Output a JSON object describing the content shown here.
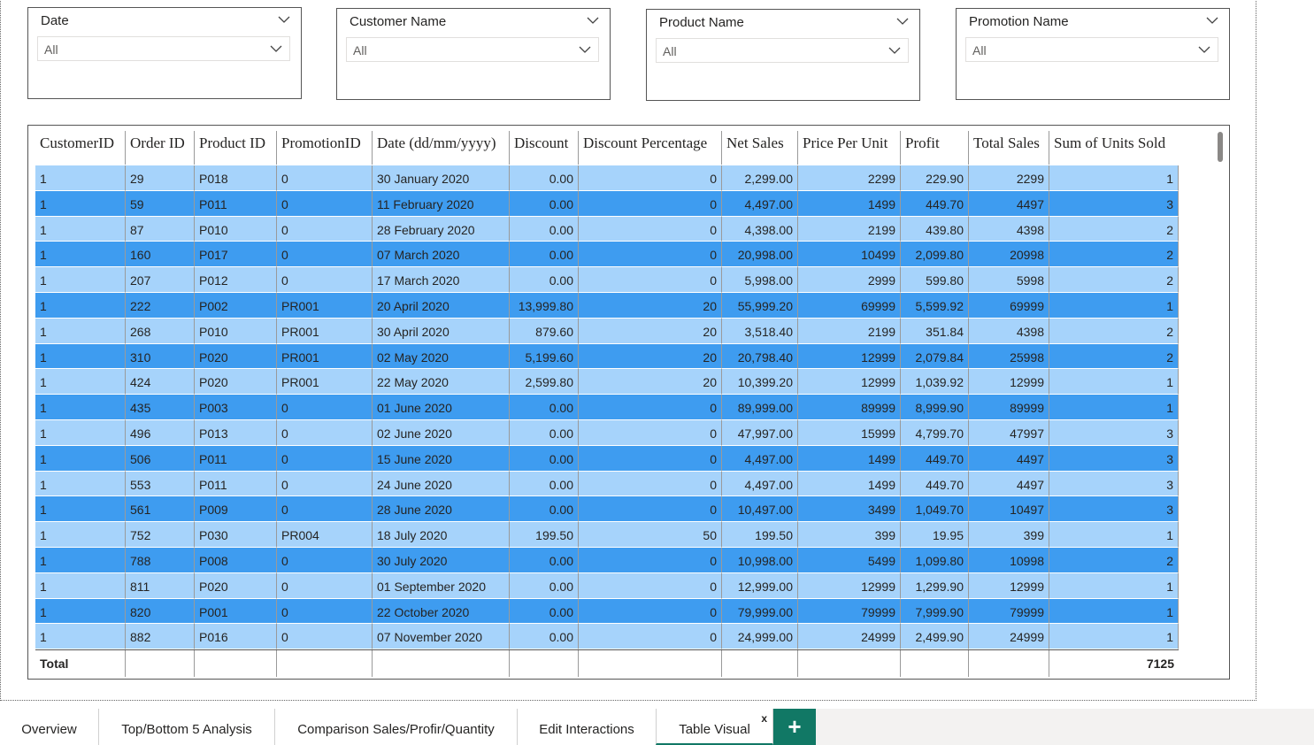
{
  "slicers": [
    {
      "title": "Date",
      "value": "All"
    },
    {
      "title": "Customer Name",
      "value": "All"
    },
    {
      "title": "Product Name",
      "value": "All"
    },
    {
      "title": "Promotion Name",
      "value": "All"
    }
  ],
  "table": {
    "columns": [
      "CustomerID",
      "Order ID",
      "Product ID",
      "PromotionID",
      "Date (dd/mm/yyyy)",
      "Discount",
      "Discount Percentage",
      "Net Sales",
      "Price Per Unit",
      "Profit",
      "Total Sales",
      "Sum of Units Sold"
    ],
    "rows": [
      [
        "1",
        "29",
        "P018",
        "0",
        "30 January 2020",
        "0.00",
        "0",
        "2,299.00",
        "2299",
        "229.90",
        "2299",
        "1"
      ],
      [
        "1",
        "59",
        "P011",
        "0",
        "11 February 2020",
        "0.00",
        "0",
        "4,497.00",
        "1499",
        "449.70",
        "4497",
        "3"
      ],
      [
        "1",
        "87",
        "P010",
        "0",
        "28 February 2020",
        "0.00",
        "0",
        "4,398.00",
        "2199",
        "439.80",
        "4398",
        "2"
      ],
      [
        "1",
        "160",
        "P017",
        "0",
        "07 March 2020",
        "0.00",
        "0",
        "20,998.00",
        "10499",
        "2,099.80",
        "20998",
        "2"
      ],
      [
        "1",
        "207",
        "P012",
        "0",
        "17 March 2020",
        "0.00",
        "0",
        "5,998.00",
        "2999",
        "599.80",
        "5998",
        "2"
      ],
      [
        "1",
        "222",
        "P002",
        "PR001",
        "20 April 2020",
        "13,999.80",
        "20",
        "55,999.20",
        "69999",
        "5,599.92",
        "69999",
        "1"
      ],
      [
        "1",
        "268",
        "P010",
        "PR001",
        "30 April 2020",
        "879.60",
        "20",
        "3,518.40",
        "2199",
        "351.84",
        "4398",
        "2"
      ],
      [
        "1",
        "310",
        "P020",
        "PR001",
        "02 May 2020",
        "5,199.60",
        "20",
        "20,798.40",
        "12999",
        "2,079.84",
        "25998",
        "2"
      ],
      [
        "1",
        "424",
        "P020",
        "PR001",
        "22 May 2020",
        "2,599.80",
        "20",
        "10,399.20",
        "12999",
        "1,039.92",
        "12999",
        "1"
      ],
      [
        "1",
        "435",
        "P003",
        "0",
        "01 June 2020",
        "0.00",
        "0",
        "89,999.00",
        "89999",
        "8,999.90",
        "89999",
        "1"
      ],
      [
        "1",
        "496",
        "P013",
        "0",
        "02 June 2020",
        "0.00",
        "0",
        "47,997.00",
        "15999",
        "4,799.70",
        "47997",
        "3"
      ],
      [
        "1",
        "506",
        "P011",
        "0",
        "15 June 2020",
        "0.00",
        "0",
        "4,497.00",
        "1499",
        "449.70",
        "4497",
        "3"
      ],
      [
        "1",
        "553",
        "P011",
        "0",
        "24 June 2020",
        "0.00",
        "0",
        "4,497.00",
        "1499",
        "449.70",
        "4497",
        "3"
      ],
      [
        "1",
        "561",
        "P009",
        "0",
        "28 June 2020",
        "0.00",
        "0",
        "10,497.00",
        "3499",
        "1,049.70",
        "10497",
        "3"
      ],
      [
        "1",
        "752",
        "P030",
        "PR004",
        "18 July 2020",
        "199.50",
        "50",
        "199.50",
        "399",
        "19.95",
        "399",
        "1"
      ],
      [
        "1",
        "788",
        "P008",
        "0",
        "30 July 2020",
        "0.00",
        "0",
        "10,998.00",
        "5499",
        "1,099.80",
        "10998",
        "2"
      ],
      [
        "1",
        "811",
        "P020",
        "0",
        "01 September 2020",
        "0.00",
        "0",
        "12,999.00",
        "12999",
        "1,299.90",
        "12999",
        "1"
      ],
      [
        "1",
        "820",
        "P001",
        "0",
        "22 October 2020",
        "0.00",
        "0",
        "79,999.00",
        "79999",
        "7,999.90",
        "79999",
        "1"
      ],
      [
        "1",
        "882",
        "P016",
        "0",
        "07 November 2020",
        "0.00",
        "0",
        "24,999.00",
        "24999",
        "2,499.90",
        "24999",
        "1"
      ]
    ],
    "totals": [
      "Total",
      "",
      "",
      "",
      "",
      "",
      "",
      "",
      "",
      "",
      "",
      "7125"
    ]
  },
  "tabs": [
    {
      "label": "Overview",
      "active": false
    },
    {
      "label": "Top/Bottom 5 Analysis",
      "active": false
    },
    {
      "label": "Comparison Sales/Profir/Quantity",
      "active": false
    },
    {
      "label": "Edit Interactions",
      "active": false
    },
    {
      "label": "Table Visual",
      "active": true
    }
  ],
  "tab_close_label": "x",
  "add_tab_label": "+",
  "colors": {
    "row_light": "#a6d3fb",
    "row_dark": "#3e9cf0",
    "accent": "#117865"
  }
}
